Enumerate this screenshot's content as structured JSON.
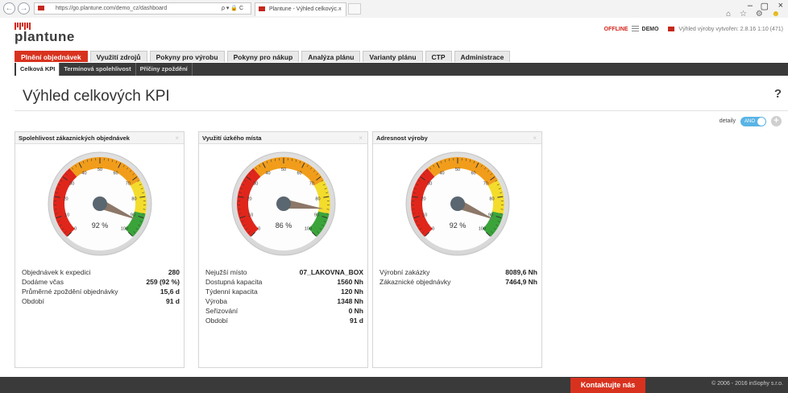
{
  "browser": {
    "url": "https://go.plantune.com/demo_cz/dashboard",
    "address_tools": "ρ ▾ 🔒 C",
    "tab_title": "Plantune - Výhled celkovýc...",
    "tab_close": "×",
    "back_glyph": "←",
    "forward_glyph": "→",
    "minimize": "–",
    "restore": "▢",
    "close": "×",
    "toolbar_icons": "⌂ ☆ ⚙"
  },
  "header": {
    "logo": "plantune",
    "offline": "OFFLINE",
    "demo": "DEMO",
    "plan_info": "Výhled výroby vytvořen: 2.8.16 1:10 (471)"
  },
  "main_tabs": [
    {
      "label": "Plnění objednávek",
      "active": true
    },
    {
      "label": "Využití zdrojů"
    },
    {
      "label": "Pokyny pro výrobu"
    },
    {
      "label": "Pokyny pro nákup"
    },
    {
      "label": "Analýza plánu"
    },
    {
      "label": "Varianty plánu"
    },
    {
      "label": "CTP"
    },
    {
      "label": "Administrace"
    }
  ],
  "sub_tabs": [
    {
      "label": "Celková KPI",
      "active": true
    },
    {
      "label": "Termínová spolehlivost"
    },
    {
      "label": "Příčiny zpoždění"
    }
  ],
  "page": {
    "title": "Výhled celkových KPI",
    "help": "?",
    "details_label": "detaily",
    "toggle_label": "ANO",
    "add": "+"
  },
  "gauge_scale": {
    "min": 0,
    "max": 100,
    "ticks": [
      "0",
      "10",
      "20",
      "30",
      "40",
      "50",
      "60",
      "70",
      "80",
      "90",
      "100"
    ],
    "zones": {
      "red": "#e0261b",
      "orange": "#f19d1b",
      "yellow": "#f3dc2b",
      "green": "#3aa43a"
    }
  },
  "widgets": [
    {
      "title": "Spolehlivost zákaznických objednávek",
      "close": "×",
      "gauge_value": 92,
      "gauge_label": "92 %",
      "rows": [
        {
          "label": "Objednávek k expedici",
          "value": "280"
        },
        {
          "label": "Dodáme včas",
          "value": "259 (92 %)"
        },
        {
          "label": "Průměrné zpoždění objednávky",
          "value": "15,6 d"
        },
        {
          "label": "Období",
          "value": "91 d"
        }
      ]
    },
    {
      "title": "Využití úzkého místa",
      "close": "×",
      "gauge_value": 86,
      "gauge_label": "86 %",
      "rows": [
        {
          "label": "Nejužší místo",
          "value": "07_LAKOVNA_BOX"
        },
        {
          "label": "Dostupná kapacita",
          "value": "1560 Nh"
        },
        {
          "label": "Týdenní kapacita",
          "value": "120 Nh"
        },
        {
          "label": "Výroba",
          "value": "1348 Nh"
        },
        {
          "label": "Seřizování",
          "value": "0 Nh"
        },
        {
          "label": "Období",
          "value": "91 d"
        }
      ]
    },
    {
      "title": "Adresnost výroby",
      "close": "×",
      "gauge_value": 92,
      "gauge_label": "92 %",
      "rows": [
        {
          "label": "Výrobní zakázky",
          "value": "8089,6 Nh"
        },
        {
          "label": "Zákaznické objednávky",
          "value": "7464,9 Nh"
        }
      ]
    }
  ],
  "footer": {
    "contact": "Kontaktujte nás",
    "copyright": "© 2006 - 2016 inSophy s.r.o."
  }
}
